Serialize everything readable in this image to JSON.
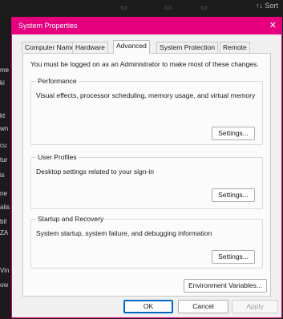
{
  "background": {
    "sort_label": "↑↓ Sort",
    "left_fragments": [
      "me",
      "ki",
      "kt",
      "wn",
      "cu",
      "tur",
      "is",
      "ne",
      "alis",
      "bil",
      "ZA",
      "Vin",
      "ow"
    ]
  },
  "dialog": {
    "title": "System Properties",
    "close_glyph": "✕",
    "tabs": [
      {
        "label": "Computer Name"
      },
      {
        "label": "Hardware"
      },
      {
        "label": "Advanced"
      },
      {
        "label": "System Protection"
      },
      {
        "label": "Remote"
      }
    ],
    "admin_notice": "You must be logged on as an Administrator to make most of these changes.",
    "performance": {
      "title": "Performance",
      "description": "Visual effects, processor scheduling, memory usage, and virtual memory",
      "button": "Settings..."
    },
    "user_profiles": {
      "title": "User Profiles",
      "description": "Desktop settings related to your sign-in",
      "button": "Settings..."
    },
    "startup_recovery": {
      "title": "Startup and Recovery",
      "description": "System startup, system failure, and debugging information",
      "button": "Settings..."
    },
    "env_button": "Environment Variables...",
    "footer": {
      "ok": "OK",
      "cancel": "Cancel",
      "apply": "Apply"
    }
  },
  "colors": {
    "titlebar": "#e6007e",
    "background": "#f0f0f0",
    "panel": "#fbfbfb",
    "focus_border": "#0067c0"
  }
}
